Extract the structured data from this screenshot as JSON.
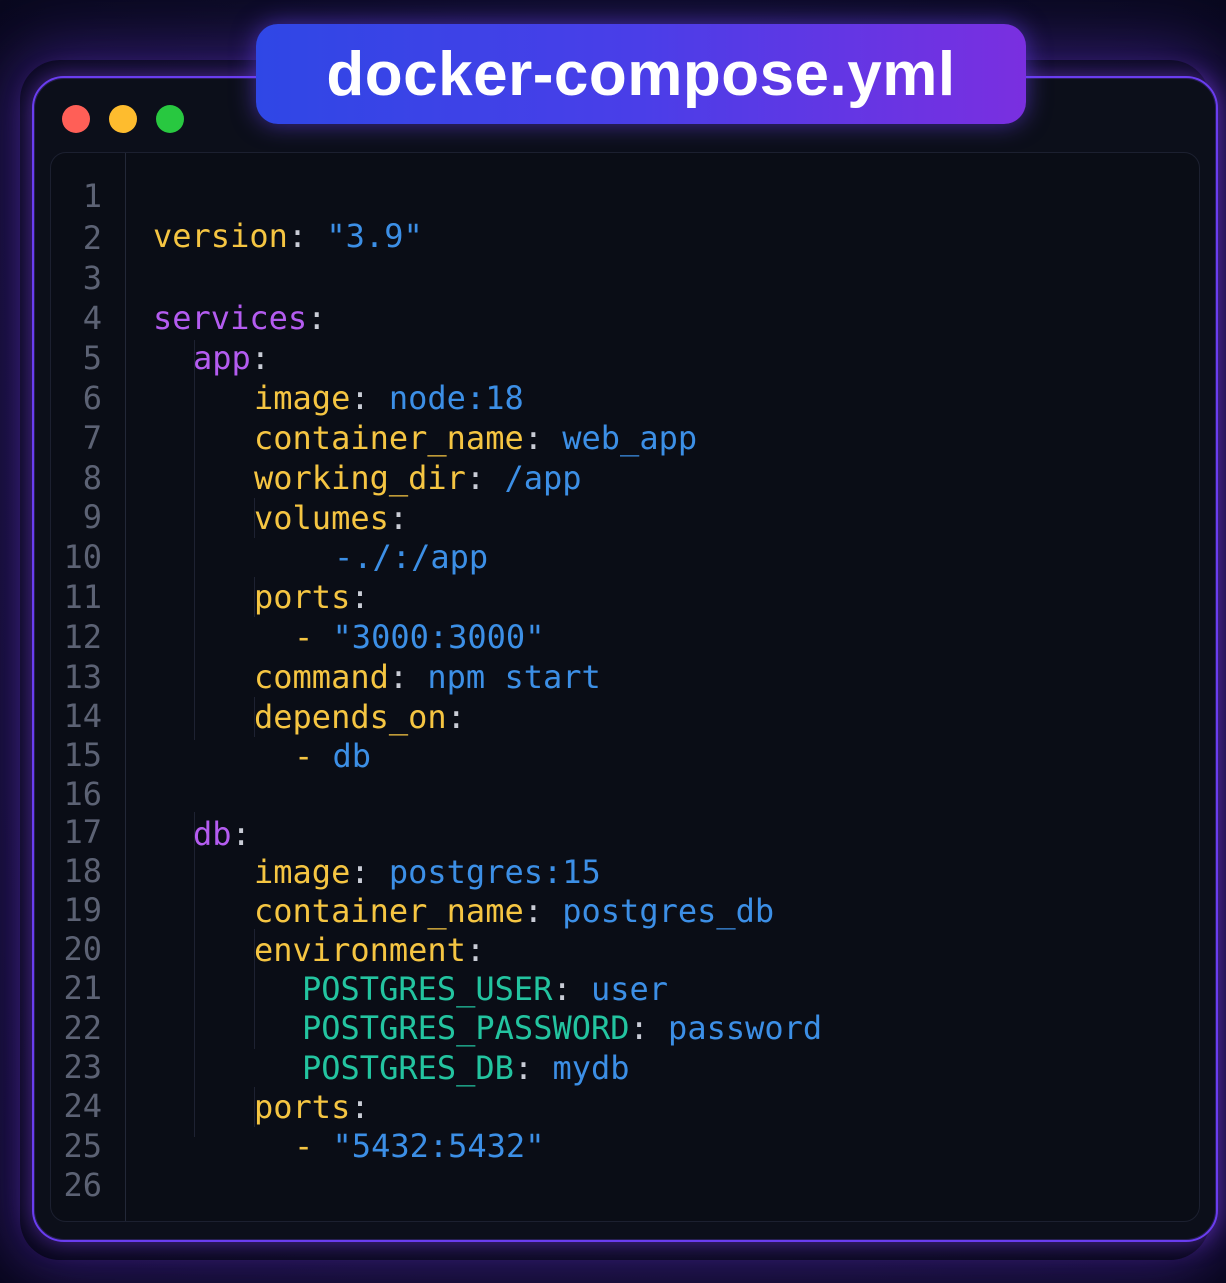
{
  "window": {
    "title": "docker-compose.yml"
  },
  "editor": {
    "line_numbers": [
      "1",
      "2",
      "3",
      "4",
      "5",
      "6",
      "7",
      "8",
      "9",
      "10",
      "11",
      "12",
      "13",
      "14",
      "15",
      "16",
      "17",
      "18",
      "19",
      "20",
      "21",
      "22",
      "23",
      "24",
      "25",
      "26"
    ],
    "lines": {
      "l1_key": "version",
      "l1_val": "\"3.9\"",
      "l3_key": "services",
      "l4_key": "app",
      "l5_key": "image",
      "l5_val": "node:18",
      "l6_key": "container_name",
      "l6_val": "web_app",
      "l7_key": "working_dir",
      "l7_val": "/app",
      "l8_key": "volumes",
      "l9_val": "-./:/app",
      "l10_key": "ports",
      "l11_dash": "-",
      "l11_val": "\"3000:3000\"",
      "l12_key": "command",
      "l12_val": "npm start",
      "l13_key": "depends_on",
      "l14_dash": "-",
      "l14_val": "db",
      "l16_key": "db",
      "l17_key": "image",
      "l17_val": "postgres:15",
      "l18_key": "container_name",
      "l18_val": "postgres_db",
      "l19_key": "environment",
      "l20_key": "POSTGRES_USER",
      "l20_val": "user",
      "l21_key": "POSTGRES_PASSWORD",
      "l21_val": "password",
      "l22_key": "POSTGRES_DB",
      "l22_val": "mydb",
      "l23_key": "ports",
      "l24_dash": "-",
      "l24_val": "\"5432:5432\""
    },
    "colon": ":"
  },
  "colors": {
    "key_top": "#f5c542",
    "key_service": "#b45cf0",
    "key_env": "#23c4a0",
    "value": "#3c8fe6",
    "line_number": "#5c6274",
    "accent_border": "#6a3df0"
  }
}
